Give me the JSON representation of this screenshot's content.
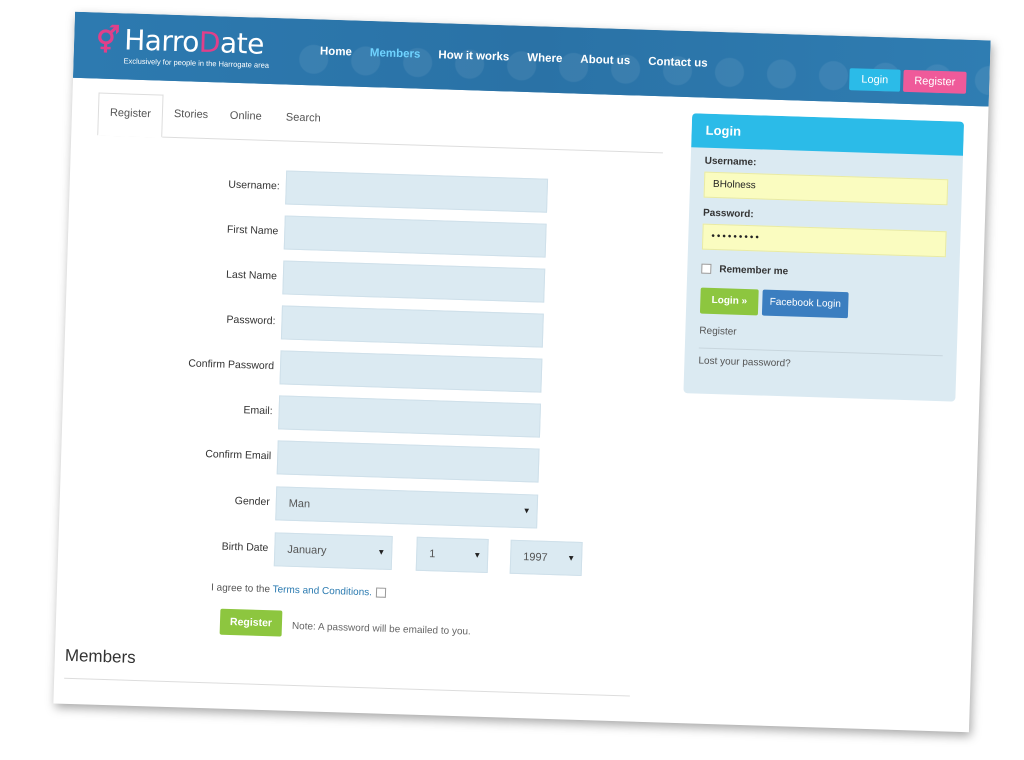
{
  "header": {
    "logo_text_a": "Harro",
    "logo_text_b": "D",
    "logo_text_c": "ate",
    "tagline": "Exclusively for people in the Harrogate area",
    "nav": [
      "Home",
      "Members",
      "How it works",
      "Where",
      "About us",
      "Contact us"
    ],
    "login_button": "Login",
    "register_button": "Register"
  },
  "tabs": [
    "Register",
    "Stories",
    "Online",
    "Search"
  ],
  "form": {
    "fields": [
      {
        "label": "Username:"
      },
      {
        "label": "First Name"
      },
      {
        "label": "Last Name"
      },
      {
        "label": "Password:"
      },
      {
        "label": "Confirm Password"
      },
      {
        "label": "Email:"
      },
      {
        "label": "Confirm Email"
      }
    ],
    "gender_label": "Gender",
    "gender_value": "Man",
    "birth_label": "Birth Date",
    "birth_month": "January",
    "birth_day": "1",
    "birth_year": "1997",
    "agree_prefix": "I agree to the ",
    "agree_link": "Terms and Conditions.",
    "register_button": "Register",
    "note": "Note: A password will be emailed to you."
  },
  "members_heading": "Members",
  "login_panel": {
    "title": "Login",
    "username_label": "Username:",
    "username_value": "BHolness",
    "password_label": "Password:",
    "password_value": "•••••••••",
    "remember_label": "Remember me",
    "login_button": "Login »",
    "facebook_button": "Facebook Login",
    "register_link": "Register",
    "lost_password_link": "Lost your password?"
  },
  "colors": {
    "header_bg": "#2c78ad",
    "accent_blue": "#2bbbe8",
    "accent_pink": "#ef5a9a",
    "accent_green": "#8dc63f",
    "facebook_blue": "#3b7ec0",
    "input_bg": "#dbeaf2"
  }
}
